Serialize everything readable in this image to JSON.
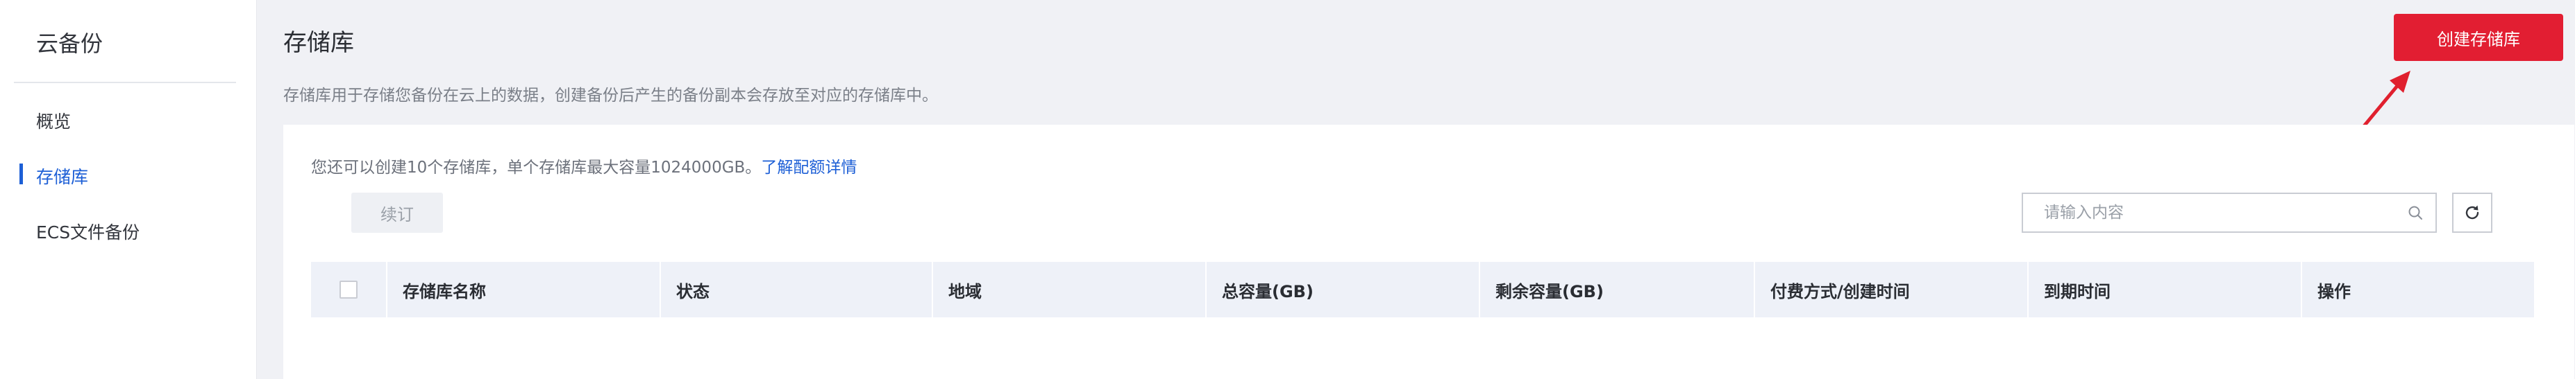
{
  "sidebar": {
    "title": "云备份",
    "items": [
      {
        "label": "概览"
      },
      {
        "label": "存储库"
      },
      {
        "label": "ECS文件备份"
      }
    ]
  },
  "header": {
    "title": "存储库",
    "description": "存储库用于存储您备份在云上的数据，创建备份后产生的备份副本会存放至对应的存储库中。",
    "create_button": "创建存储库"
  },
  "card": {
    "quota_text": "您还可以创建10个存储库，单个存储库最大容量1024000GB。",
    "quota_link": "了解配额详情",
    "renew_button": "续订",
    "search_placeholder": "请输入内容"
  },
  "table": {
    "columns": [
      "存储库名称",
      "状态",
      "地域",
      "总容量(GB)",
      "剩余容量(GB)",
      "付费方式/创建时间",
      "到期时间",
      "操作"
    ],
    "rows": []
  },
  "icons": {
    "search": "search-icon",
    "refresh": "refresh-icon",
    "arrow": "annotation-arrow"
  },
  "colors": {
    "brand_red": "#e21e32",
    "link_blue": "#1d5fd6",
    "annotation_red": "#e0202e"
  }
}
